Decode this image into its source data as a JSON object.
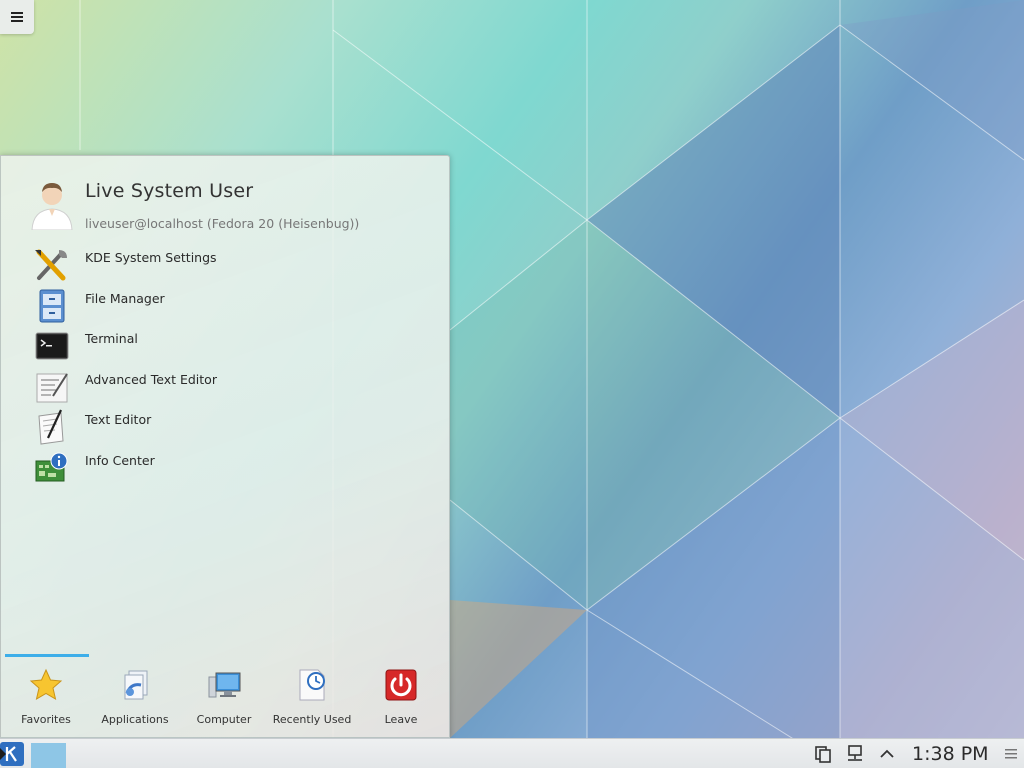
{
  "desktop": {
    "toolbox_icon": "hamburger-menu-icon"
  },
  "launcher": {
    "user": {
      "name": "Live System User",
      "host": "liveuser@localhost (Fedora 20 (Heisenbug))",
      "avatar_icon": "user-avatar-icon"
    },
    "favorites": [
      {
        "label": "KDE System Settings",
        "icon": "system-settings-icon"
      },
      {
        "label": "File Manager",
        "icon": "file-manager-icon"
      },
      {
        "label": "Terminal",
        "icon": "terminal-icon"
      },
      {
        "label": "Advanced Text Editor",
        "icon": "advanced-text-editor-icon"
      },
      {
        "label": "Text Editor",
        "icon": "text-editor-icon"
      },
      {
        "label": "Info Center",
        "icon": "info-center-icon"
      }
    ],
    "tabs": [
      {
        "label": "Favorites",
        "icon": "star-icon",
        "active": true
      },
      {
        "label": "Applications",
        "icon": "applications-icon",
        "active": false
      },
      {
        "label": "Computer",
        "icon": "computer-icon",
        "active": false
      },
      {
        "label": "Recently Used",
        "icon": "clock-icon",
        "active": false
      },
      {
        "label": "Leave",
        "icon": "power-icon",
        "active": false
      }
    ],
    "accent_color": "#3daee9"
  },
  "panel": {
    "clock": "1:38 PM",
    "tray_icons": [
      "clipboard-icon",
      "network-icon",
      "show-hidden-icon"
    ],
    "menu_icon": "panel-menu-icon"
  }
}
